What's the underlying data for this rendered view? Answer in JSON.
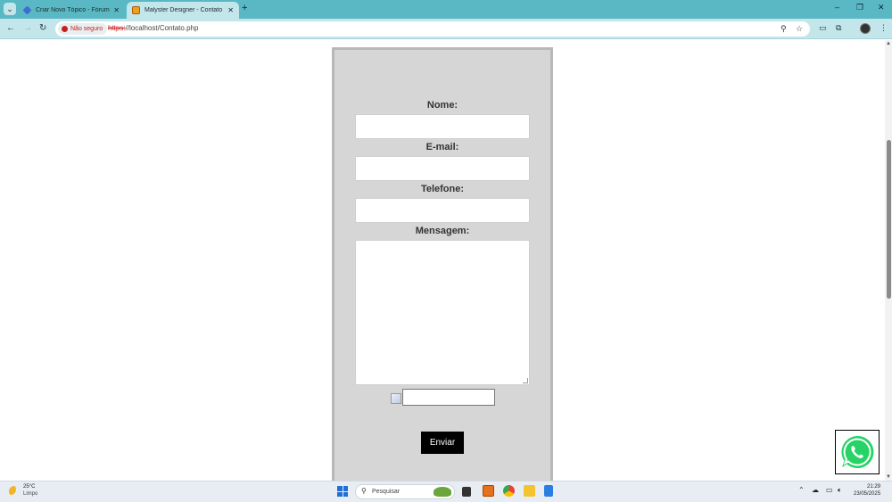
{
  "browser": {
    "tabs": [
      {
        "title": "Criar Novo Tópico - Fórum iMa",
        "active": false,
        "favicon": "cube-icon"
      },
      {
        "title": "Malyster Designer - Contato",
        "active": true,
        "favicon": "md-logo-icon"
      }
    ],
    "new_tab_symbol": "+",
    "tab_close_symbol": "✕",
    "window_controls": {
      "minimize": "–",
      "restore": "❐",
      "close": "✕"
    },
    "security_label": "Não seguro",
    "url_scheme": "https:",
    "url_rest": "//localhost/Contato.php"
  },
  "form": {
    "name_label": "Nome:",
    "email_label": "E-mail:",
    "phone_label": "Telefone:",
    "message_label": "Mensagem:",
    "name_value": "",
    "email_value": "",
    "phone_value": "",
    "message_value": "",
    "captcha_value": "",
    "submit_label": "Enviar"
  },
  "taskbar": {
    "temperature": "25°C",
    "weather": "Limpo",
    "search_placeholder": "Pesquisar",
    "time": "21:29",
    "date": "23/05/2025"
  },
  "colors": {
    "tab_strip": "#5ab8c4",
    "toolbar": "#c3e6eb",
    "form_background": "#d6d6d6",
    "submit_button": "#000000",
    "whatsapp": "#25d366"
  }
}
